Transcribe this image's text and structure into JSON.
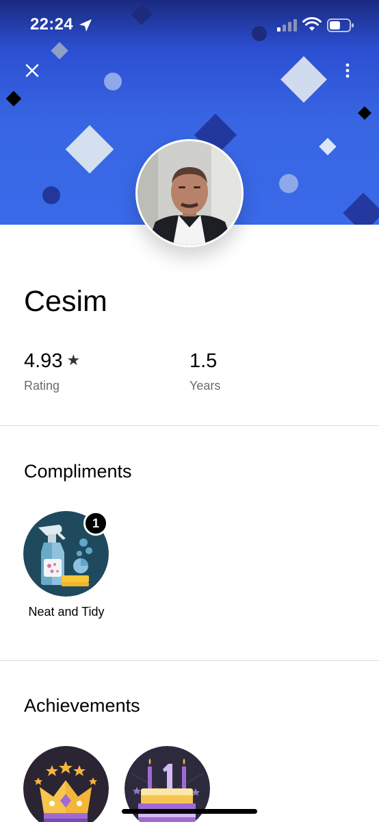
{
  "status_bar": {
    "time": "22:24",
    "icons": [
      "location-arrow-icon",
      "cellular-signal-icon",
      "wifi-icon",
      "battery-icon"
    ]
  },
  "header": {
    "close_icon": "close-icon",
    "more_icon": "more-vertical-icon",
    "banner_color": "#3866e3"
  },
  "profile": {
    "name": "Cesim",
    "stats": [
      {
        "value": "4.93",
        "label": "Rating",
        "icon": "star-icon"
      },
      {
        "value": "1.5",
        "label": "Years"
      }
    ]
  },
  "compliments": {
    "title": "Compliments",
    "items": [
      {
        "label": "Neat and Tidy",
        "count": "1",
        "icon": "spray-bottle-icon"
      }
    ]
  },
  "achievements": {
    "title": "Achievements",
    "items": [
      {
        "icon": "crown-icon"
      },
      {
        "icon": "anniversary-cake-icon"
      }
    ]
  }
}
